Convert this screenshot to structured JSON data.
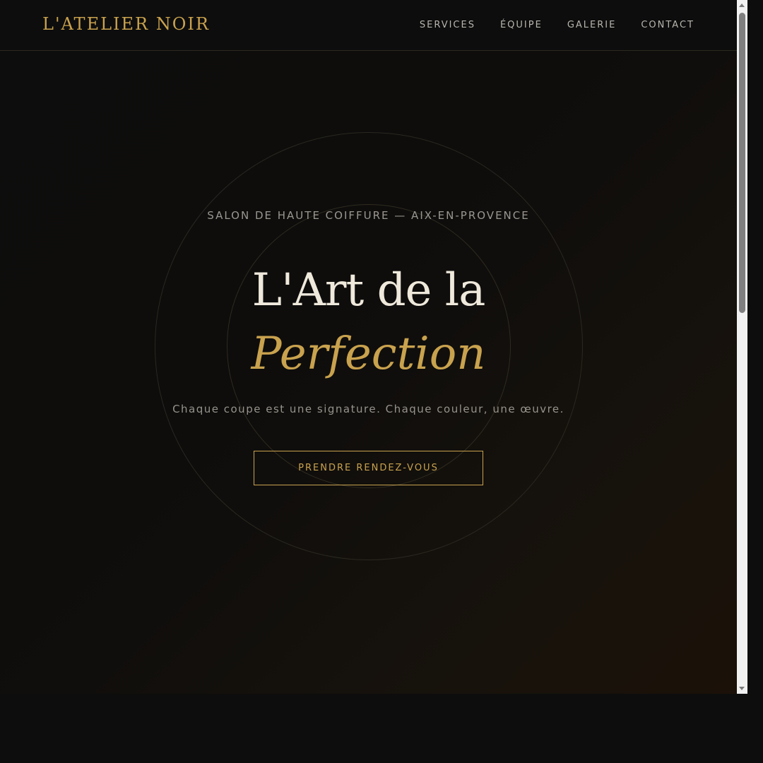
{
  "brand": {
    "logo": "L'ATELIER NOIR"
  },
  "nav": {
    "items": [
      {
        "label": "SERVICES"
      },
      {
        "label": "ÉQUIPE"
      },
      {
        "label": "GALERIE"
      },
      {
        "label": "CONTACT"
      }
    ]
  },
  "hero": {
    "subtitle": "SALON DE HAUTE COIFFURE — AIX-EN-PROVENCE",
    "headline_line1": "L'Art de la",
    "headline_line2": "Perfection",
    "tagline": "Chaque coupe est une signature. Chaque couleur, une œuvre.",
    "cta_label": "PRENDRE RENDEZ-VOUS"
  },
  "colors": {
    "background": "#0d0d0d",
    "gold": "#c9a24e",
    "cream": "#efe9dc",
    "muted": "#9a9790"
  },
  "icons": {
    "scroll_up": "triangle-up-icon",
    "scroll_down": "triangle-down-icon"
  }
}
